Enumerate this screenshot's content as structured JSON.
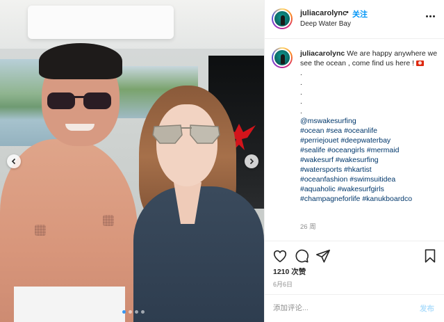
{
  "header": {
    "username": "juliacarolync",
    "separator": "•",
    "follow_label": "关注",
    "location": "Deep Water Bay"
  },
  "caption": {
    "username": "juliacarolync",
    "text": "We are happy anywhere we see the ocean , come find us here !",
    "flag_icon": "hong-kong-flag",
    "dot_lines": [
      ".",
      ".",
      ".",
      ".",
      "."
    ],
    "mention": "@mswakesurfing",
    "hashtag_lines": [
      [
        "#ocean",
        "#sea",
        "#oceanlife"
      ],
      [
        "#perriejouet",
        "#deepwaterbay"
      ],
      [
        "#sealife",
        "#oceangirls",
        "#mermaid"
      ],
      [
        "#wakesurf",
        "#wakesurfing"
      ],
      [
        "#watersports",
        "#hkartist"
      ],
      [
        "#oceanfashion",
        "#swimsuitidea"
      ],
      [
        "#aquaholic",
        "#wakesurfgirls"
      ],
      [
        "#champagneforlife",
        "#kanukboardco"
      ]
    ],
    "age": "26 周"
  },
  "actions": {
    "icons": [
      "heart-icon",
      "comment-icon",
      "share-icon",
      "bookmark-icon"
    ],
    "likes": "1210 次赞",
    "date": "6月6日"
  },
  "comment": {
    "placeholder": "添加评论...",
    "post_label": "发布"
  },
  "carousel": {
    "total_slides": 4,
    "active_slide": 1
  },
  "colors": {
    "link": "#00376b",
    "follow": "#0095f6",
    "post_disabled": "#b2dffc",
    "meta": "#8e8e8e",
    "carousel_dot_active": "#3897f0"
  }
}
